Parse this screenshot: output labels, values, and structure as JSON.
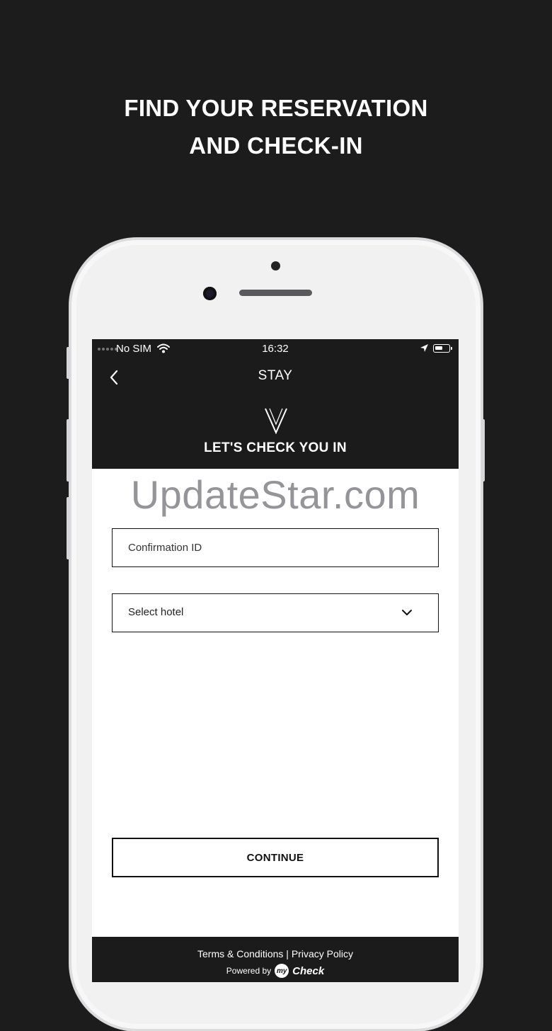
{
  "promo": {
    "line1": "FIND YOUR RESERVATION",
    "line2": "AND CHECK-IN"
  },
  "status_bar": {
    "carrier": "No SIM",
    "time": "16:32"
  },
  "header": {
    "title": "STAY",
    "logo_letter": "V",
    "subtitle": "LET'S CHECK YOU IN"
  },
  "watermark": "UpdateStar.com",
  "form": {
    "confirmation_placeholder": "Confirmation ID",
    "hotel_select_label": "Select hotel",
    "continue_label": "CONTINUE"
  },
  "footer": {
    "terms": "Terms & Conditions",
    "separator": " | ",
    "privacy": "Privacy Policy",
    "powered_by": "Powered by",
    "brand_badge": "my",
    "brand_name": "Check"
  },
  "colors": {
    "background": "#1c1c1d",
    "header_bg": "#1b1b1b",
    "phone_body": "#f1f1f2",
    "accent": "#111111"
  }
}
